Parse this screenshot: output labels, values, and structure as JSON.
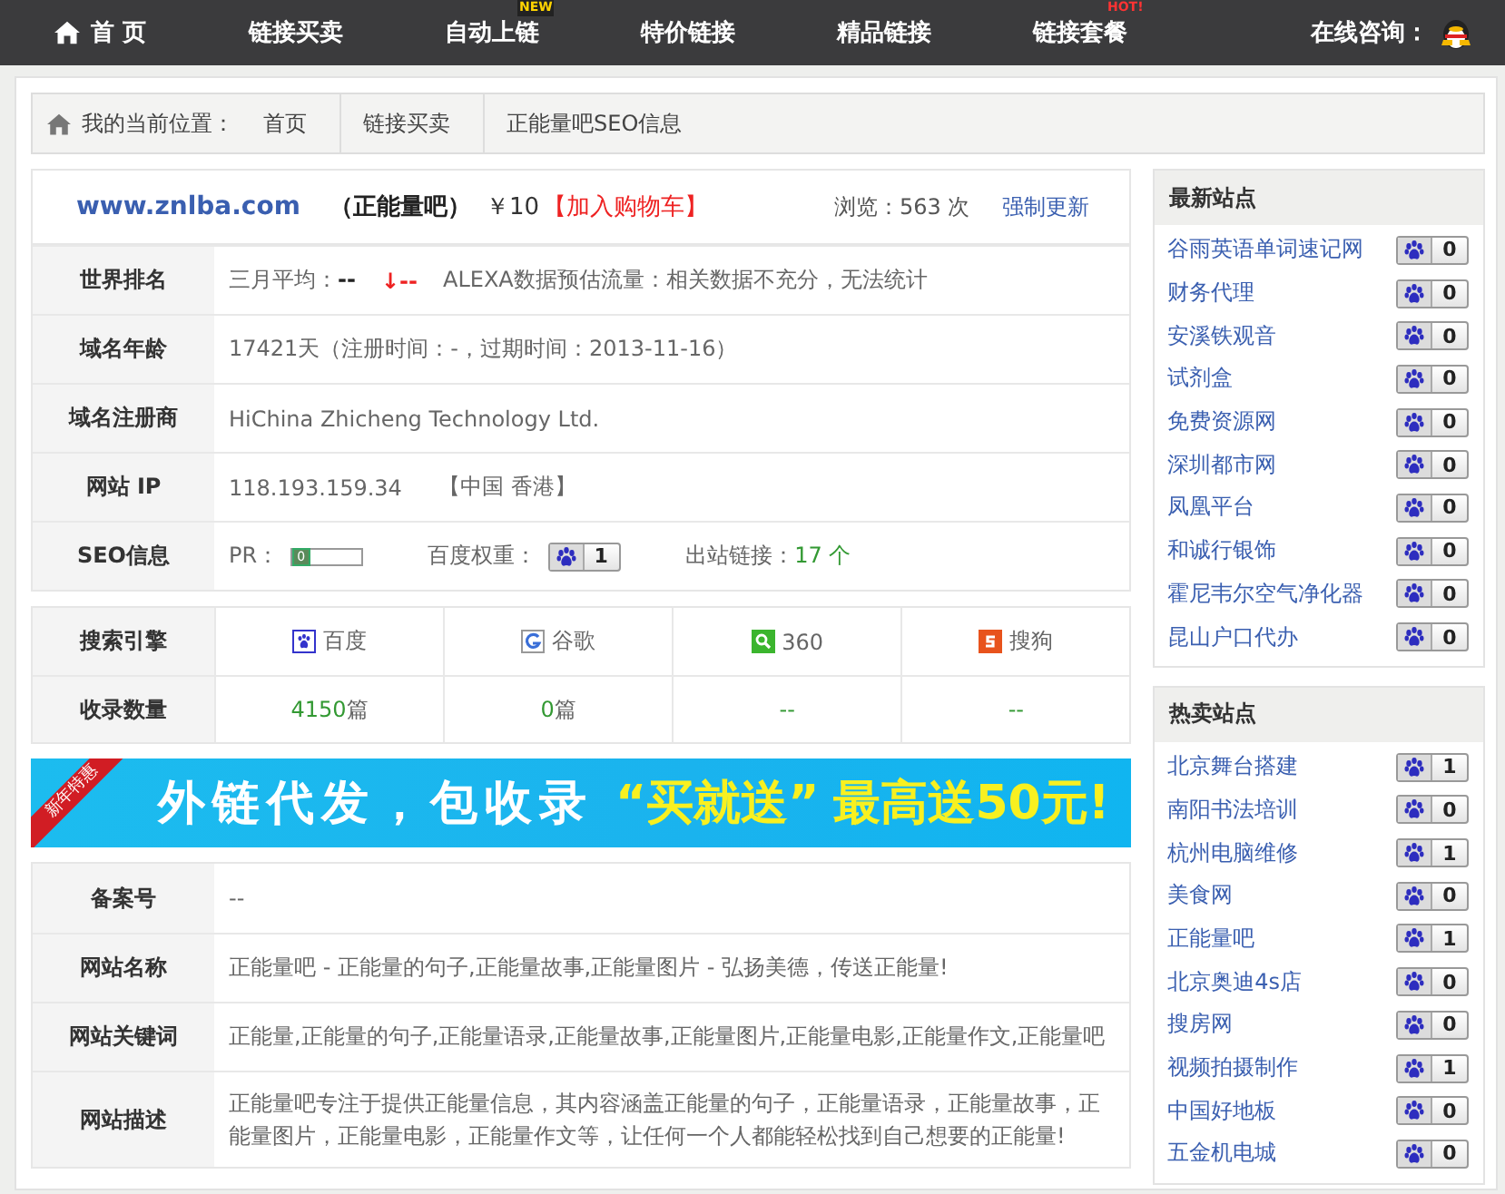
{
  "nav": {
    "items": [
      {
        "label": "首 页",
        "kind": "home"
      },
      {
        "label": "链接买卖",
        "kind": "plain"
      },
      {
        "label": "自动上链",
        "kind": "plain",
        "badge": "NEW"
      },
      {
        "label": "特价链接",
        "kind": "plain"
      },
      {
        "label": "精品链接",
        "kind": "plain"
      },
      {
        "label": "链接套餐",
        "kind": "plain",
        "badge": "HOT!"
      }
    ],
    "consult": "在线咨询："
  },
  "breadcrumb": {
    "label": "我的当前位置：",
    "items": [
      "首页",
      "链接买卖",
      "正能量吧SEO信息"
    ]
  },
  "site": {
    "domain": "www.znlba.com",
    "name": "（正能量吧）",
    "price": "￥10",
    "cart": "【加入购物车】",
    "views_label": "浏览：",
    "views": "563 次",
    "refresh": "强制更新"
  },
  "info_rows": [
    {
      "kind": "rank",
      "label": "世界排名",
      "avg_label": "三月平均：",
      "avg_value": "--",
      "trend": "↓--",
      "alexa": "ALEXA数据预估流量：相关数据不充分，无法统计"
    },
    {
      "kind": "text",
      "label": "域名年龄",
      "value": "17421天（注册时间：-，过期时间：2013-11-16）"
    },
    {
      "kind": "text",
      "label": "域名注册商",
      "value": "HiChina Zhicheng Technology Ltd."
    },
    {
      "kind": "ip",
      "label": "网站 IP",
      "value": "118.193.159.34",
      "location": "【中国 香港】"
    },
    {
      "kind": "seo",
      "label": "SEO信息",
      "pr_label": "PR：",
      "pr_value": "0",
      "level": 0,
      "baidu_label": "百度权重：",
      "baidu_value": "1",
      "out_label": "出站链接：",
      "out_value": "17 个"
    }
  ],
  "engines": {
    "label": "搜索引擎",
    "count_label": "收录数量",
    "items": [
      {
        "kind": "baidu",
        "name": "百度",
        "count": "4150",
        "unit": "篇"
      },
      {
        "kind": "google",
        "name": "谷歌",
        "count": "0",
        "unit": "篇"
      },
      {
        "kind": "so360",
        "name": "360",
        "count": "--"
      },
      {
        "kind": "sogou",
        "name": "搜狗",
        "count": "--"
      }
    ]
  },
  "banner": {
    "ribbon": "新年特惠",
    "text": "外链代发，包收录",
    "highlight": "“买就送”",
    "offer": "最高送50元!"
  },
  "details": [
    {
      "label": "备案号",
      "value": "--"
    },
    {
      "label": "网站名称",
      "value": "正能量吧 - 正能量的句子,正能量故事,正能量图片 - 弘扬美德，传送正能量!"
    },
    {
      "label": "网站关键词",
      "value": "正能量,正能量的句子,正能量语录,正能量故事,正能量图片,正能量电影,正能量作文,正能量吧"
    },
    {
      "label": "网站描述",
      "value": "正能量吧专注于提供正能量信息，其内容涵盖正能量的句子，正能量语录，正能量故事，正能量图片，正能量电影，正能量作文等，让任何一个人都能轻松找到自己想要的正能量!"
    }
  ],
  "panels": [
    {
      "title": "最新站点",
      "items": [
        {
          "name": "谷雨英语单词速记网",
          "value": "0"
        },
        {
          "name": "财务代理",
          "value": "0"
        },
        {
          "name": "安溪铁观音",
          "value": "0"
        },
        {
          "name": "试剂盒",
          "value": "0"
        },
        {
          "name": "免费资源网",
          "value": "0"
        },
        {
          "name": "深圳都市网",
          "value": "0"
        },
        {
          "name": "凤凰平台",
          "value": "0"
        },
        {
          "name": "和诚行银饰",
          "value": "0"
        },
        {
          "name": "霍尼韦尔空气净化器",
          "value": "0"
        },
        {
          "name": "昆山户口代办",
          "value": "0"
        }
      ]
    },
    {
      "title": "热卖站点",
      "items": [
        {
          "name": "北京舞台搭建",
          "value": "1"
        },
        {
          "name": "南阳书法培训",
          "value": "0"
        },
        {
          "name": "杭州电脑维修",
          "value": "1"
        },
        {
          "name": "美食网",
          "value": "0"
        },
        {
          "name": "正能量吧",
          "value": "1"
        },
        {
          "name": "北京奥迪4s店",
          "value": "0"
        },
        {
          "name": "搜房网",
          "value": "0"
        },
        {
          "name": "视频拍摄制作",
          "value": "1"
        },
        {
          "name": "中国好地板",
          "value": "0"
        },
        {
          "name": "五金机电城",
          "value": "0"
        }
      ]
    }
  ]
}
